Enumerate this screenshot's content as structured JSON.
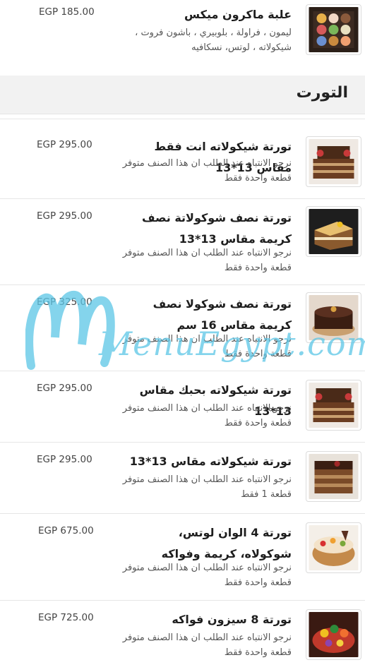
{
  "section": {
    "title": "التورت"
  },
  "items": [
    {
      "name": "علبة ماكرون ميكس",
      "desc": [
        "ليمون ، فراولة ، بلوبيري ، باشون فروت ،",
        "شيكولاته ، لوتس، نسكافيه"
      ],
      "price": "EGP 185.00"
    },
    {
      "name": "تورتة شيكولاته انت فقط مقاس 13*13",
      "desc": [
        "نرجو الانتباه عند الطلب ان هذا الصنف متوفر",
        "قطعة واحدة فقط"
      ],
      "price": "EGP 295.00"
    },
    {
      "name": "تورتة نصف شوكولاتة نصف كريمة مقاس 13*13",
      "desc": [
        "نرجو الانتباه عند الطلب ان هذا الصنف متوفر",
        "قطعة واحدة فقط"
      ],
      "price": "EGP 295.00"
    },
    {
      "name": "تورتة نصف شوكولا نصف كريمة مقاس 16 سم",
      "desc": [
        "نرجو الانتباه عند الطلب ان هذا الصنف متوفر",
        "قطعة واحدة فقط"
      ],
      "price": "EGP 325.00"
    },
    {
      "name": "تورتة شيكولاته بحبك مقاس 13*13",
      "desc": [
        "نرجو الانتباه عند الطلب ان هذا الصنف متوفر",
        "قطعة واحدة فقط"
      ],
      "price": "EGP 295.00"
    },
    {
      "name": "تورتة شيكولاته مقاس 13*13",
      "desc": [
        "نرجو الانتباه عند الطلب ان هذا الصنف متوفر",
        "قطعة 1 فقط"
      ],
      "price": "EGP 295.00"
    },
    {
      "name": "تورتة 4 الوان لوتس، شوكولاه، كريمة وفواكه",
      "desc": [
        "نرجو الانتباه عند الطلب ان هذا الصنف متوفر",
        "قطعة واحدة فقط"
      ],
      "price": "EGP 675.00"
    },
    {
      "name": "تورتة 8 سيزون فواكه",
      "desc": [
        "نرجو الانتباه عند الطلب ان هذا الصنف متوفر",
        "قطعة واحدة فقط"
      ],
      "price": "EGP 725.00"
    }
  ],
  "watermark": {
    "text": "MenuEgypt.com"
  },
  "colors": {
    "watermark": "#5cc6e6",
    "section_bg": "#f2f2f2",
    "divider": "#e6e6e6"
  }
}
